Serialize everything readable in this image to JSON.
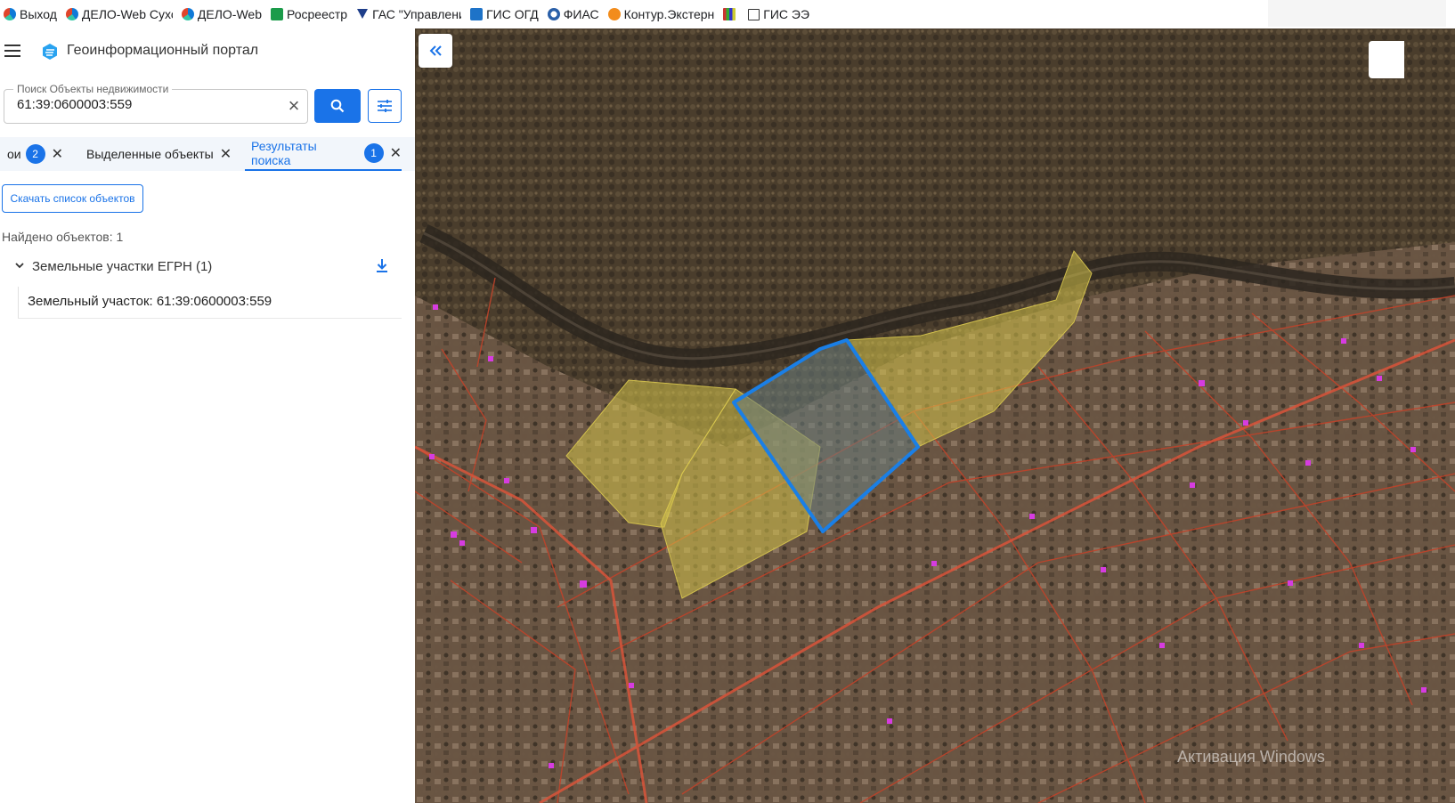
{
  "bookmarks": [
    {
      "label": "Выход",
      "icon": "edge-icon"
    },
    {
      "label": "ДЕЛО-Web Сухор",
      "icon": "edge-icon"
    },
    {
      "label": "ДЕЛО-Web",
      "icon": "edge-icon"
    },
    {
      "label": "Росреестр",
      "icon": "rosreestr-icon"
    },
    {
      "label": "ГАС \"Управление",
      "icon": "gas-icon"
    },
    {
      "label": "ГИС ОГД",
      "icon": "gis-ogd-icon"
    },
    {
      "label": "ФИАС",
      "icon": "fias-icon"
    },
    {
      "label": "Контур.Экстерн",
      "icon": "kontur-icon"
    },
    {
      "label": "",
      "icon": "books-icon"
    },
    {
      "label": "ГИС ЭЭ",
      "icon": "gis-ee-icon"
    }
  ],
  "header": {
    "title": "Геоинформационный портал"
  },
  "search": {
    "legend": "Поиск Объекты недвижимости",
    "value": "61:39:0600003:559"
  },
  "tabs": [
    {
      "label": "ои",
      "badge": "2"
    },
    {
      "label": "Выделенные объекты"
    },
    {
      "label": "Результаты поиска",
      "badge": "1",
      "active": true
    }
  ],
  "results": {
    "download_label": "Скачать список объектов",
    "found_text": "Найдено объектов: 1",
    "group_label": "Земельные участки ЕГРН (1)",
    "item_label": "Земельный участок: 61:39:0600003:559"
  },
  "map": {
    "watermark": "Активация Windows",
    "colors": {
      "selected_outline": "#1a7fe6",
      "parcel_fill": "#d4c24a",
      "cadastral_lines": "#c0432a",
      "building_marks": "#d63ce0"
    }
  },
  "colors": {
    "accent": "#1a73e8",
    "tab_bar": "#f2f6fb"
  }
}
